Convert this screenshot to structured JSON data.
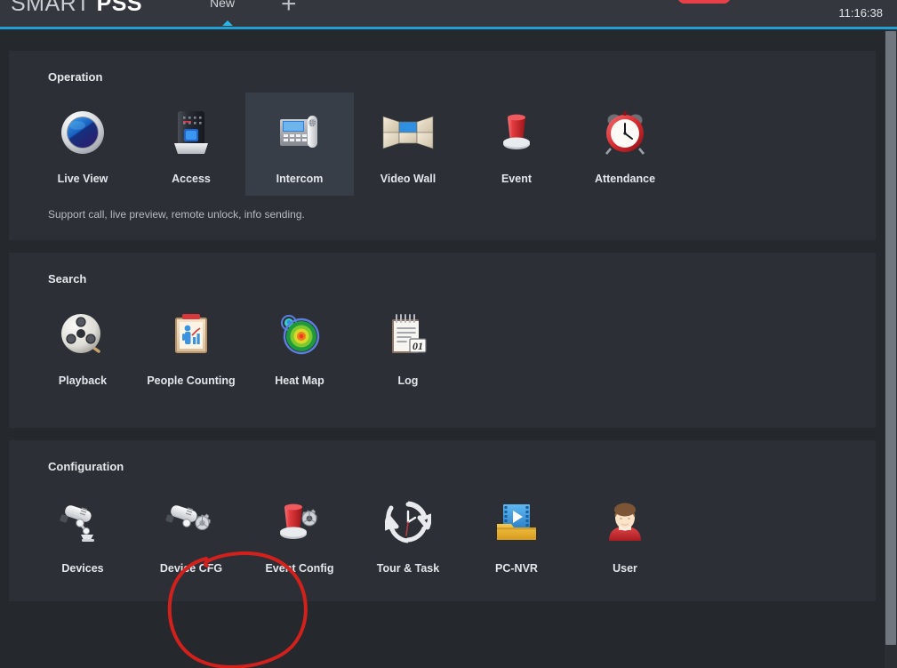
{
  "app": {
    "logo_prefix": "SMART",
    "logo_suffix": "PSS",
    "clock": "11:16:38",
    "tab_label": "New",
    "add_tab_label": "+",
    "overflow_label": "···",
    "accent_color": "#1f9fd4",
    "badge_color": "#e8404a"
  },
  "sections": [
    {
      "title": "Operation",
      "description": "Support call, live preview, remote unlock, info sending.",
      "tiles": [
        {
          "label": "Live View",
          "icon": "live-view-icon",
          "selected": false
        },
        {
          "label": "Access",
          "icon": "access-icon",
          "selected": false
        },
        {
          "label": "Intercom",
          "icon": "intercom-icon",
          "selected": true
        },
        {
          "label": "Video Wall",
          "icon": "video-wall-icon",
          "selected": false
        },
        {
          "label": "Event",
          "icon": "event-icon",
          "selected": false
        },
        {
          "label": "Attendance",
          "icon": "attendance-icon",
          "selected": false
        }
      ]
    },
    {
      "title": "Search",
      "description": "",
      "tiles": [
        {
          "label": "Playback",
          "icon": "playback-icon",
          "selected": false
        },
        {
          "label": "People Counting",
          "icon": "people-counting-icon",
          "selected": false
        },
        {
          "label": "Heat Map",
          "icon": "heat-map-icon",
          "selected": false
        },
        {
          "label": "Log",
          "icon": "log-icon",
          "selected": false
        }
      ]
    },
    {
      "title": "Configuration",
      "description": "",
      "tiles": [
        {
          "label": "Devices",
          "icon": "devices-icon",
          "selected": false
        },
        {
          "label": "Device CFG",
          "icon": "device-cfg-icon",
          "selected": false
        },
        {
          "label": "Event Config",
          "icon": "event-config-icon",
          "selected": false
        },
        {
          "label": "Tour & Task",
          "icon": "tour-task-icon",
          "selected": false
        },
        {
          "label": "PC-NVR",
          "icon": "pc-nvr-icon",
          "selected": false
        },
        {
          "label": "User",
          "icon": "user-icon",
          "selected": false
        }
      ]
    }
  ],
  "annotation": {
    "target": "Device CFG",
    "color": "#d2201c",
    "shape": "hand-drawn-ellipse"
  }
}
